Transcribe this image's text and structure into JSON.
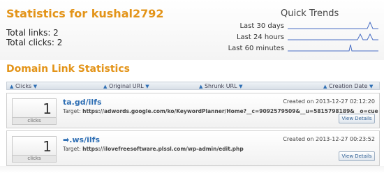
{
  "header": {
    "title": "Statistics for kushal2792",
    "total_links": "Total links: 2",
    "total_clicks": "Total clicks: 2"
  },
  "quick_trends": {
    "title": "Quick Trends",
    "rows": [
      {
        "label": "Last 30 days"
      },
      {
        "label": "Last 24 hours"
      },
      {
        "label": "Last 60 minutes"
      }
    ],
    "line_color": "#4a6fc4"
  },
  "section": {
    "title": "Domain Link Statistics"
  },
  "columns": {
    "clicks": "Clicks",
    "original_url": "Original URL",
    "shrunk_url": "Shrunk URL",
    "creation_date": "Creation Date",
    "sort_arrow_up": "▲",
    "sort_arrow_down": "▼"
  },
  "links": [
    {
      "clicks": "1",
      "clicks_label": "clicks",
      "short_url": "ta.gd/ilfs",
      "created": "Created on 2013-12-27 02:12:20",
      "target_label": "Target:",
      "target_url": "https://adwords.google.com/ko/KeywordPlanner/Home?__c=9092579509&__u=5815798189&__o=cue",
      "button": "View Details"
    },
    {
      "clicks": "1",
      "clicks_label": "clicks",
      "short_url": "➡.ws/ilfs",
      "created": "Created on 2013-12-27 00:23:52",
      "target_label": "Target:",
      "target_url": "https://ilovefreesoftware.plssl.com/wp-admin/edit.php",
      "button": "View Details"
    }
  ],
  "colors": {
    "accent_orange": "#e39419",
    "link_blue": "#2f6fb4"
  }
}
